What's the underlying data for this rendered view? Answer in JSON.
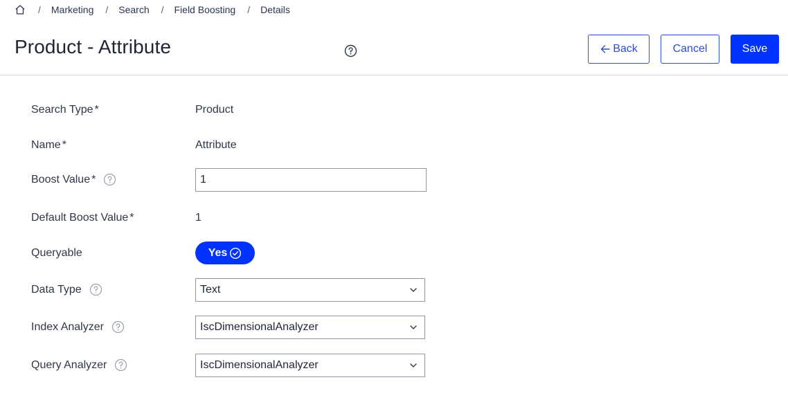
{
  "breadcrumb": {
    "items": [
      "Marketing",
      "Search",
      "Field Boosting",
      "Details"
    ],
    "separator": "/"
  },
  "header": {
    "title": "Product - Attribute",
    "back_label": "Back",
    "cancel_label": "Cancel",
    "save_label": "Save"
  },
  "form": {
    "search_type": {
      "label": "Search Type",
      "required": "*",
      "value": "Product"
    },
    "name": {
      "label": "Name",
      "required": "*",
      "value": "Attribute"
    },
    "boost_value": {
      "label": "Boost Value",
      "required": "*",
      "value": "1"
    },
    "default_boost_value": {
      "label": "Default Boost Value",
      "required": "*",
      "value": "1"
    },
    "queryable": {
      "label": "Queryable",
      "value": "Yes"
    },
    "data_type": {
      "label": "Data Type",
      "value": "Text"
    },
    "index_analyzer": {
      "label": "Index Analyzer",
      "value": "IscDimensionalAnalyzer"
    },
    "query_analyzer": {
      "label": "Query Analyzer",
      "value": "IscDimensionalAnalyzer"
    }
  },
  "colors": {
    "accent": "#0033ff",
    "outline_button": "#2b4bd8",
    "divider": "#cfd3da"
  },
  "icons": [
    "home-icon",
    "help-icon",
    "arrow-left-icon",
    "check-circle-icon",
    "chevron-down-icon"
  ]
}
